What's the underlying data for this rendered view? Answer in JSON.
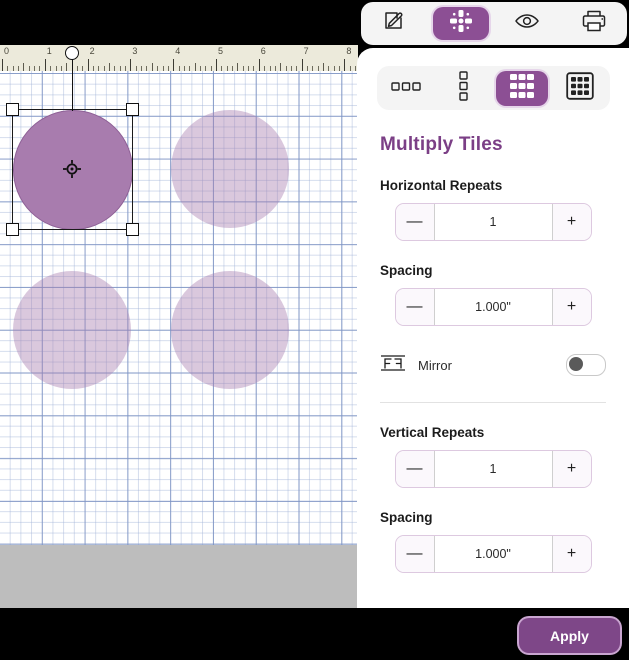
{
  "topbar": {
    "buttons": [
      {
        "name": "edit-tool",
        "icon": "pencil-square-icon",
        "active": false
      },
      {
        "name": "transform-tool",
        "icon": "move-arrows-icon",
        "active": true
      },
      {
        "name": "preview-tool",
        "icon": "eye-icon",
        "active": false
      },
      {
        "name": "print-tool",
        "icon": "printer-icon",
        "active": false
      }
    ]
  },
  "panel": {
    "layout_modes": [
      {
        "name": "row-layout",
        "icon": "three-squares-row-icon",
        "active": false
      },
      {
        "name": "column-layout",
        "icon": "three-squares-column-icon",
        "active": false
      },
      {
        "name": "grid-layout",
        "icon": "grid-nine-icon",
        "active": true
      },
      {
        "name": "framed-grid-layout",
        "icon": "grid-nine-framed-icon",
        "active": false
      }
    ],
    "title": "Multiply Tiles",
    "horizontal_repeats": {
      "label": "Horizontal Repeats",
      "value": "1",
      "minus": "—",
      "plus": "+"
    },
    "horizontal_spacing": {
      "label": "Spacing",
      "value": "1.000\"",
      "minus": "—",
      "plus": "+"
    },
    "mirror": {
      "label": "Mirror",
      "icon": "mirror-f-icon",
      "enabled": false
    },
    "vertical_repeats": {
      "label": "Vertical Repeats",
      "value": "1",
      "minus": "—",
      "plus": "+"
    },
    "vertical_spacing": {
      "label": "Spacing",
      "value": "1.000\"",
      "minus": "—",
      "plus": "+"
    }
  },
  "bottom": {
    "apply_label": "Apply"
  },
  "canvas": {
    "ruler": {
      "unit": "inch",
      "labels": [
        "0",
        "1",
        "2",
        "3",
        "4",
        "5",
        "6",
        "7",
        "8"
      ]
    },
    "shapes": [
      {
        "name": "selected-circle",
        "selected": true
      },
      {
        "name": "preview-circle-top-right",
        "selected": false
      },
      {
        "name": "preview-circle-bottom-left",
        "selected": false
      },
      {
        "name": "preview-circle-bottom-right",
        "selected": false
      }
    ]
  },
  "colors": {
    "accent": "#8c4f94",
    "title": "#7b3f86",
    "shape_fill": "#a87cae",
    "shape_ghost": "#d5c3dd",
    "apply_bg": "#7e4788",
    "ruler_bg": "#eceadb",
    "grid_line": "#7e94c4"
  }
}
